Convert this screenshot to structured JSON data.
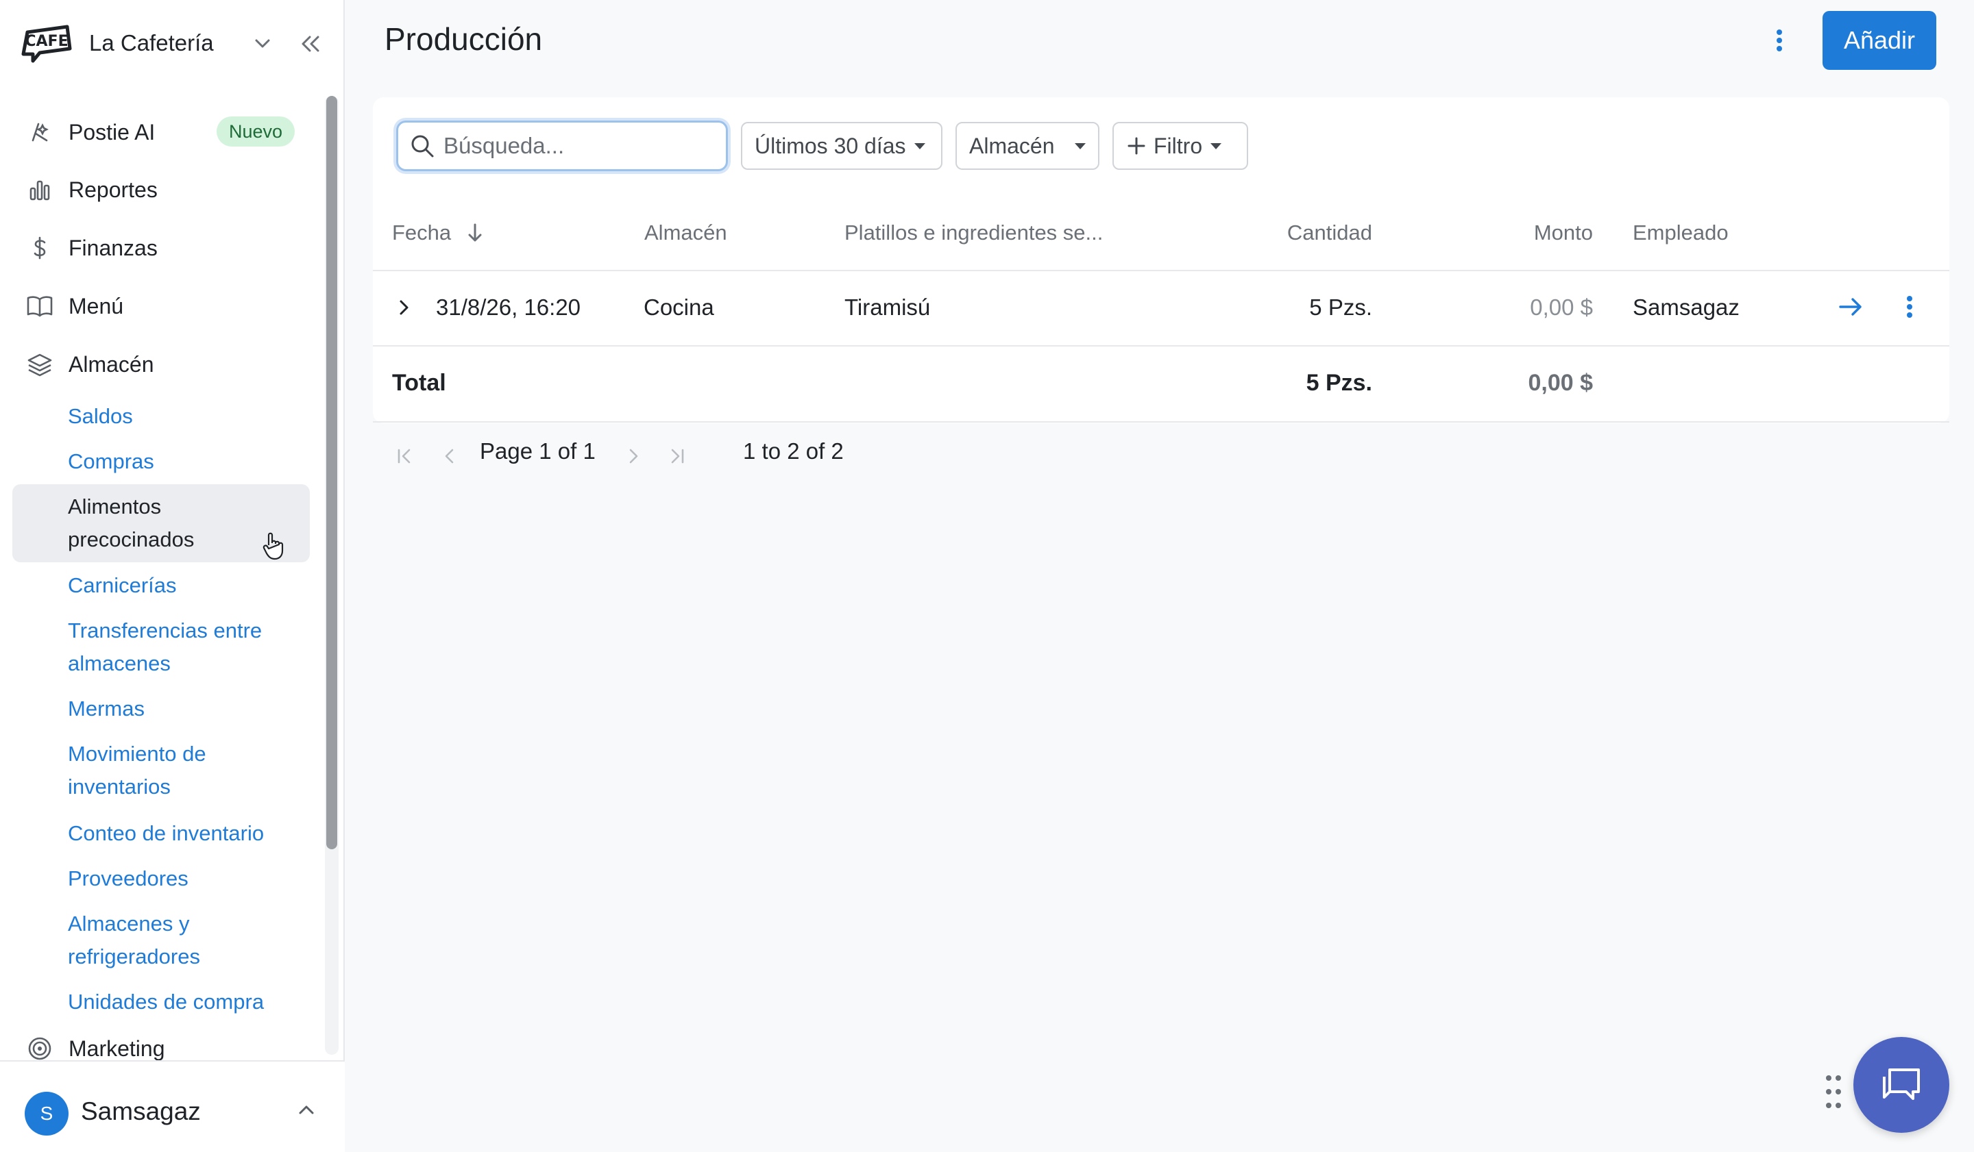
{
  "brand": {
    "name": "La Cafetería",
    "logo_text": "CAFE"
  },
  "sidebar": {
    "items": [
      {
        "label": "Postie AI",
        "icon": "ai-sparkle-icon",
        "badge": "Nuevo"
      },
      {
        "label": "Reportes",
        "icon": "bar-chart-icon"
      },
      {
        "label": "Finanzas",
        "icon": "dollar-icon"
      },
      {
        "label": "Menú",
        "icon": "book-icon"
      },
      {
        "label": "Almacén",
        "icon": "layers-icon"
      },
      {
        "label": "Marketing",
        "icon": "target-icon"
      }
    ],
    "subitems": [
      "Saldos",
      "Compras",
      "Alimentos precocinados",
      "Carnicerías",
      "Transferencias entre almacenes",
      "Mermas",
      "Movimiento de inventarios",
      "Conteo de inventario",
      "Proveedores",
      "Almacenes y refrigeradores",
      "Unidades de compra"
    ],
    "active_subitem": "Alimentos precocinados"
  },
  "user": {
    "initial": "S",
    "name": "Samsagaz"
  },
  "page": {
    "title": "Producción",
    "add_label": "Añadir"
  },
  "toolbar": {
    "search_placeholder": "Búsqueda...",
    "period_label": "Últimos 30 días",
    "warehouse_label": "Almacén",
    "filter_label": "Filtro"
  },
  "table": {
    "headers": [
      "Fecha",
      "Almacén",
      "Platillos e ingredientes se...",
      "Cantidad",
      "Monto",
      "Empleado"
    ],
    "rows": [
      {
        "fecha": "31/8/26, 16:20",
        "almacen": "Cocina",
        "platillo": "Tiramisú",
        "cantidad": "5 Pzs.",
        "monto": "0,00 $",
        "empleado": "Samsagaz"
      }
    ],
    "total": {
      "label": "Total",
      "cantidad": "5 Pzs.",
      "monto": "0,00 $"
    }
  },
  "pagination": {
    "page_label": "Page",
    "page": "1",
    "of_label": "of",
    "pages": "1",
    "range_text": "1 to 2 of 2"
  },
  "colors": {
    "accent": "#1f7bd8",
    "badge_bg": "#d4f3dd",
    "chat": "#4d63c2"
  }
}
